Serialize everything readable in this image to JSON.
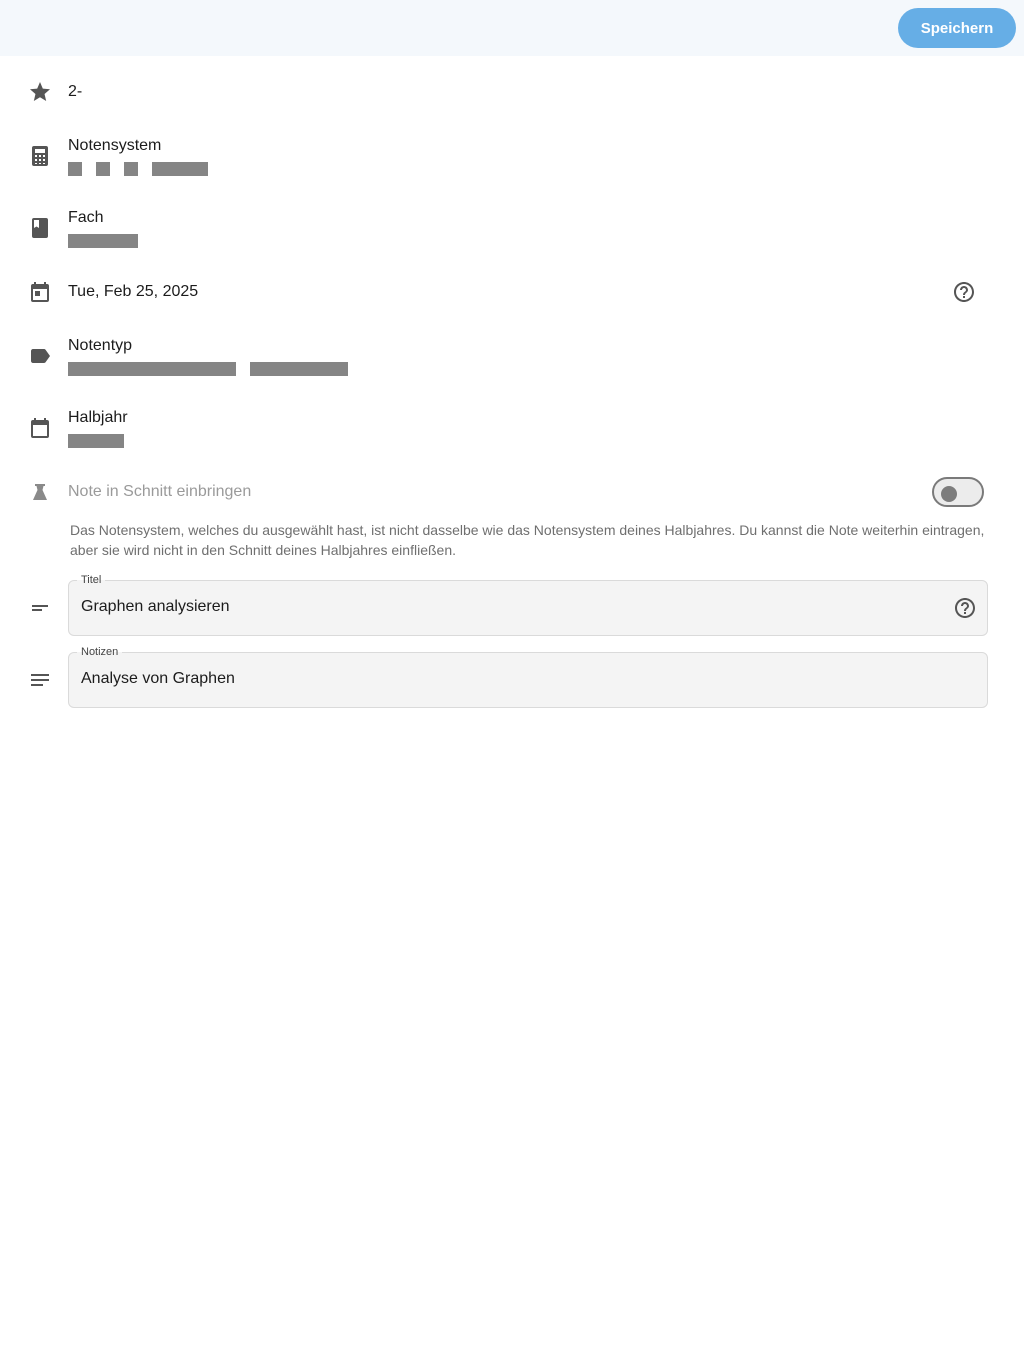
{
  "toolbar": {
    "save_label": "Speichern",
    "accent_color": "#66aee6"
  },
  "grade": {
    "value": "2-"
  },
  "grading_system": {
    "label": "Notensystem"
  },
  "subject": {
    "label": "Fach"
  },
  "date": {
    "value": "Tue, Feb 25, 2025"
  },
  "grade_type": {
    "label": "Notentyp"
  },
  "semester": {
    "label": "Halbjahr"
  },
  "include_in_average": {
    "label": "Note in Schnitt einbringen",
    "enabled": false,
    "notice": "Das Notensystem, welches du ausgewählt hast, ist nicht dasselbe wie das Notensystem deines Halbjahres. Du kannst die Note weiterhin eintragen, aber sie wird nicht in den Schnitt deines Halbjahres einfließen."
  },
  "title_field": {
    "label": "Titel",
    "value": "Graphen analysieren"
  },
  "notes_field": {
    "label": "Notizen",
    "value": "Analyse von Graphen"
  },
  "icons": {
    "grade": "star-icon",
    "grading_system": "calculator-icon",
    "subject": "book-icon",
    "date": "calendar-today-icon",
    "date_help": "help-circle-icon",
    "grade_type": "label-tag-icon",
    "semester": "calendar-icon",
    "include_in_average": "flask-icon",
    "title": "short-text-icon",
    "title_help": "help-circle-icon",
    "notes": "notes-icon"
  }
}
